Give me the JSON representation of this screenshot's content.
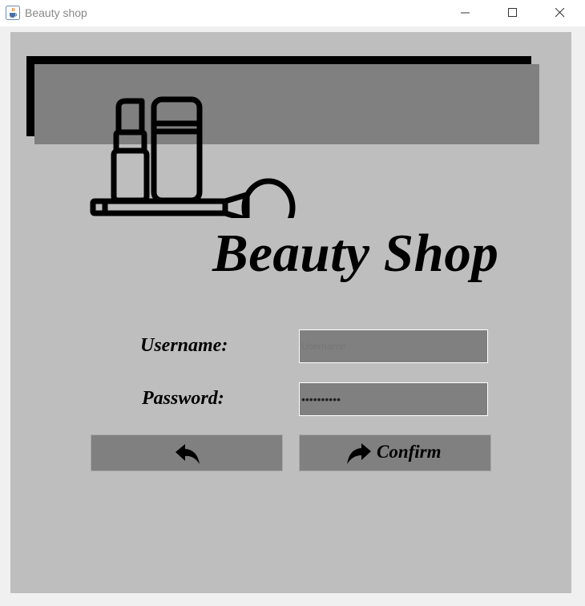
{
  "window": {
    "title": "Beauty shop",
    "icon": "java-cup-icon"
  },
  "header": {
    "logo_icon": "cosmetics-lipstick-brush-icon",
    "title": "Beauty Shop"
  },
  "form": {
    "username": {
      "label": "Username:",
      "placeholder": "Username"
    },
    "password": {
      "label": "Password:",
      "value": "••••••••••"
    }
  },
  "buttons": {
    "back": {
      "icon": "arrow-back-icon"
    },
    "confirm": {
      "icon": "arrow-forward-icon",
      "label": "Confirm"
    }
  },
  "colors": {
    "panel": "#bebebe",
    "banner": "#808080",
    "field": "#808080"
  }
}
